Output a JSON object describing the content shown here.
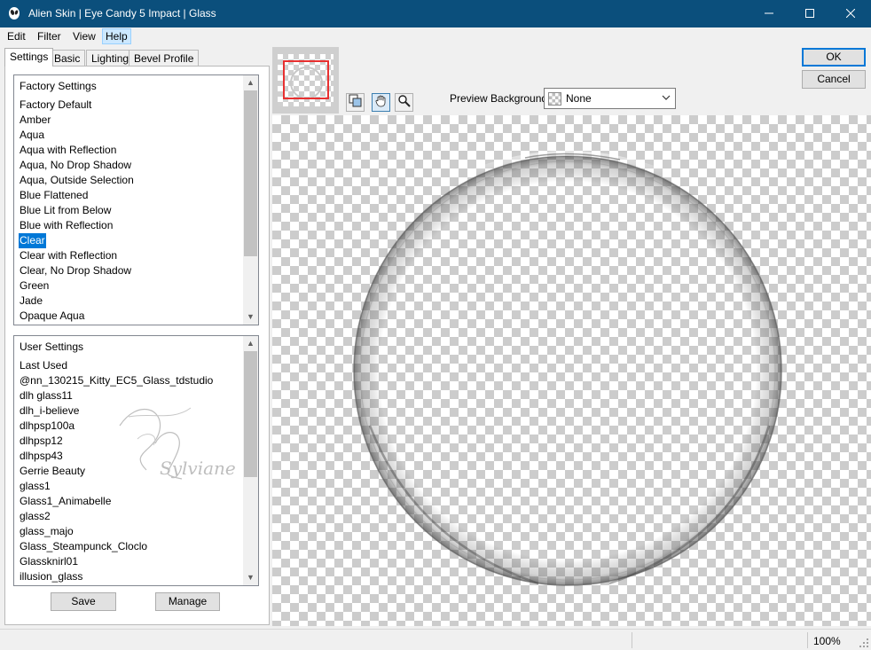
{
  "window": {
    "title": "Alien Skin | Eye Candy 5 Impact | Glass",
    "icons": {
      "app": "alien-skin-icon",
      "minimize": "minimize-icon",
      "maximize": "maximize-icon",
      "close": "close-icon"
    }
  },
  "menu": [
    "Edit",
    "Filter",
    "View",
    "Help"
  ],
  "tabs": [
    "Settings",
    "Basic",
    "Lighting",
    "Bevel Profile"
  ],
  "factory_settings": {
    "header": "Factory Settings",
    "items": [
      "Factory Default",
      "Amber",
      "Aqua",
      "Aqua with Reflection",
      "Aqua, No Drop Shadow",
      "Aqua, Outside Selection",
      "Blue Flattened",
      "Blue Lit from Below",
      "Blue with Reflection",
      "Clear",
      "Clear with Reflection",
      "Clear, No Drop Shadow",
      "Green",
      "Jade",
      "Opaque Aqua"
    ],
    "selected": "Clear"
  },
  "user_settings": {
    "header": "User Settings",
    "items": [
      "Last Used",
      "@nn_130215_Kitty_EC5_Glass_tdstudio",
      "dlh glass11",
      "dlh_i-believe",
      "dlhpsp100a",
      "dlhpsp12",
      "dlhpsp43",
      "Gerrie Beauty",
      "glass1",
      "Glass1_Animabelle",
      "glass2",
      "glass_majo",
      "Glass_Steampunck_Cloclo",
      "Glassknirl01",
      "illusion_glass"
    ]
  },
  "buttons": {
    "save": "Save",
    "manage": "Manage",
    "ok": "OK",
    "cancel": "Cancel"
  },
  "tools": [
    "preview-pan-icon",
    "hand-icon",
    "zoom-icon"
  ],
  "preview_background": {
    "label": "Preview Background:",
    "value": "None"
  },
  "watermark_text": "Sylviane",
  "status": {
    "zoom": "100%"
  },
  "colors": {
    "titlebar": "#0b4f7c",
    "selection": "#0078d7",
    "default_button_border": "#0078d7"
  }
}
